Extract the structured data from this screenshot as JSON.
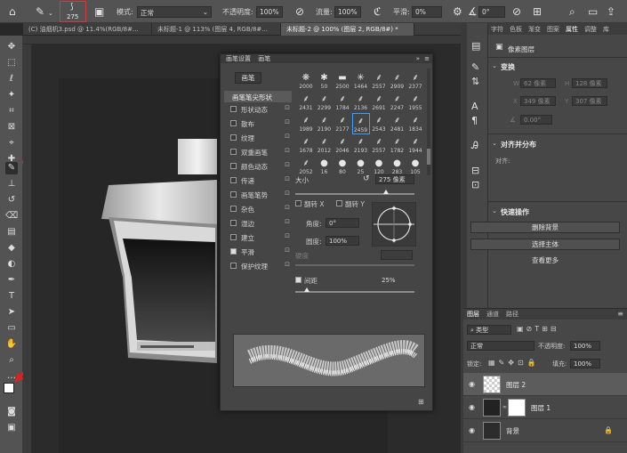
{
  "options_bar": {
    "brush_size": "275",
    "mode_label": "模式:",
    "mode_value": "正常",
    "opacity_label": "不透明度:",
    "opacity_value": "100%",
    "flow_label": "流量:",
    "flow_value": "100%",
    "smooth_label": "平滑:",
    "smooth_value": "0%",
    "angle_value": "0°"
  },
  "tabs": [
    {
      "label": "(C) 油烟机3.psd @ 11.4%(RGB/8#...",
      "active": false
    },
    {
      "label": "未标题-1 @ 113% (图层 4, RGB/8#...",
      "active": false
    },
    {
      "label": "未标题-2 @ 100% (图层 2, RGB/8#) *",
      "active": true
    }
  ],
  "brush_panel": {
    "tab_brush_settings": "画笔设置",
    "tab_brush": "画笔",
    "brush_button": "画笔",
    "tip_shape": "画笔笔尖形状",
    "options": [
      {
        "label": "形状动态",
        "checked": false
      },
      {
        "label": "散布",
        "checked": false
      },
      {
        "label": "纹理",
        "checked": false
      },
      {
        "label": "双重画笔",
        "checked": false
      },
      {
        "label": "颜色动态",
        "checked": false
      },
      {
        "label": "传递",
        "checked": false
      },
      {
        "label": "画笔笔势",
        "checked": false
      },
      {
        "label": "杂色",
        "checked": false
      },
      {
        "label": "湿边",
        "checked": false
      },
      {
        "label": "建立",
        "checked": false
      },
      {
        "label": "平滑",
        "checked": true
      },
      {
        "label": "保护纹理",
        "checked": false
      }
    ],
    "presets": [
      "2000",
      "50",
      "2500",
      "1464",
      "2557",
      "2909",
      "2377",
      "2431",
      "2299",
      "1784",
      "2136",
      "2691",
      "2247",
      "1955",
      "1989",
      "2190",
      "2177",
      "2459",
      "2543",
      "2481",
      "1834",
      "1678",
      "2012",
      "2046",
      "2193",
      "2557",
      "1782",
      "1944",
      "2052",
      "16",
      "80",
      "25",
      "120",
      "283",
      "105"
    ],
    "size_label": "大小",
    "size_value": "275 像素",
    "flip_x": "翻转 X",
    "flip_y": "翻转 Y",
    "angle_label": "角度:",
    "angle_value": "0°",
    "roundness_label": "圆度:",
    "roundness_value": "100%",
    "hardness_label": "硬度",
    "spacing_label": "间距",
    "spacing_value": "25%"
  },
  "properties": {
    "tabs": [
      "字符",
      "色板",
      "渐变",
      "图案",
      "属性",
      "调整",
      "库"
    ],
    "title": "像素图层",
    "transform": "变换",
    "w_label": "W",
    "w_value": "62 像素",
    "h_label": "H",
    "h_value": "128 像素",
    "x_label": "X",
    "x_value": "349 像素",
    "y_label": "Y",
    "y_value": "307 像素",
    "rot_value": "0.00°",
    "align": "对齐并分布",
    "align_sub": "对齐:",
    "quick": "快速操作",
    "remove_bg": "删除背景",
    "select_subject": "选择主体",
    "more": "查看更多"
  },
  "layers_panel": {
    "tabs": [
      "图层",
      "通道",
      "路径"
    ],
    "kind_label": "类型",
    "blend": "正常",
    "opacity_label": "不透明度:",
    "opacity_value": "100%",
    "lock_label": "锁定:",
    "fill_label": "填充:",
    "fill_value": "100%",
    "layers": [
      {
        "name": "图层 2",
        "selected": true
      },
      {
        "name": "图层 1",
        "selected": false
      },
      {
        "name": "背景",
        "selected": false
      }
    ]
  }
}
